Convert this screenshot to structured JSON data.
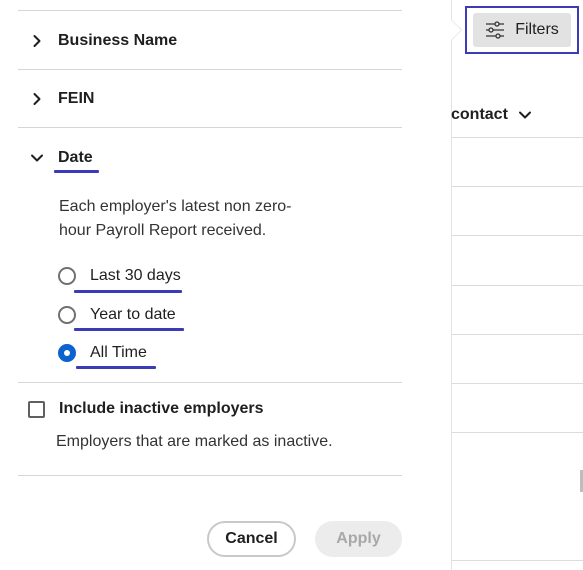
{
  "panel": {
    "sections": [
      {
        "label": "Business Name",
        "expanded": false
      },
      {
        "label": "FEIN",
        "expanded": false
      },
      {
        "label": "Date",
        "expanded": true
      }
    ],
    "date": {
      "description": "Each employer's latest non zero-hour Payroll Report received.",
      "options": [
        {
          "label": "Last 30 days",
          "checked": false
        },
        {
          "label": "Year to date",
          "checked": false
        },
        {
          "label": "All Time",
          "checked": true
        }
      ]
    },
    "inactive": {
      "label": "Include inactive employers",
      "description": "Employers that are marked as inactive.",
      "checked": false
    },
    "buttons": {
      "cancel": "Cancel",
      "apply": "Apply"
    }
  },
  "background": {
    "column_header": "contact",
    "filters_label": "Filters"
  },
  "colors": {
    "accent": "#3b3bb8",
    "radio_selected": "#0b63ce",
    "disabled_bg": "#ececec",
    "disabled_text": "#a8a8a8"
  }
}
